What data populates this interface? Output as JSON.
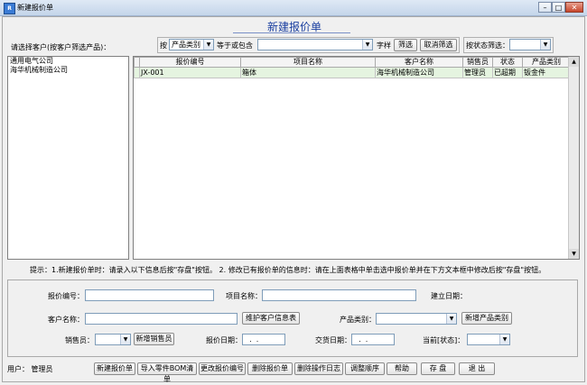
{
  "window": {
    "title": "新建报价单",
    "app_icon": "app-icon"
  },
  "heading": "新建报价单",
  "customer_filter_label": "请选择客户(按客户筛选产品)：",
  "customers": [
    "通用电气公司",
    "海华机械制造公司"
  ],
  "filter": {
    "by_label": "按",
    "field_value": "产品类别",
    "op_value": "等于或包含",
    "keyword_value": "",
    "char_label": "字样",
    "filter_button": "筛选",
    "cancel_button": "取消筛选",
    "status_label": "按状态筛选：",
    "status_value": ""
  },
  "table": {
    "columns": [
      "报价编号",
      "项目名称",
      "客户名称",
      "销售员",
      "状态",
      "产品类别"
    ],
    "rows": [
      [
        "JX-001",
        "箱体",
        "海华机械制造公司",
        "管理员",
        "已超期",
        "钣金件"
      ]
    ]
  },
  "hint": "提示：1.新建报价单时：请录入以下信息后按\"存盘\"按钮。  2. 修改已有报价单的信息时：请在上面表格中单击选中报价单并在下方文本框中修改后按\"存盘\"按钮。",
  "form": {
    "quote_no_label": "报价编号：",
    "quote_no_value": "",
    "project_label": "项目名称：",
    "project_value": "",
    "created_label": "建立日期：",
    "created_value": "",
    "customer_label": "客户名称：",
    "customer_value": "",
    "maintain_customer_button": "维护客户信息表",
    "category_label": "产品类别：",
    "category_value": "",
    "new_category_button": "新增产品类别",
    "sales_label": "销售员：",
    "sales_value": "",
    "new_sales_button": "新增销售员",
    "quote_date_label": "报价日期：",
    "quote_date_value": "  .  .",
    "delivery_label": "交货日期：",
    "delivery_value": "  .  .",
    "cur_status_label": "当前[状态]：",
    "cur_status_value": ""
  },
  "footer": {
    "user_label": "用户：",
    "user_value": "管理员",
    "buttons": [
      "新建报价单",
      "导入零件BOM清单",
      "更改报价编号",
      "删除报价单",
      "删除操作日志",
      "调整顺序",
      "帮助",
      "存 盘",
      "退 出"
    ]
  },
  "colors": {
    "heading": "#1a3fa0",
    "selected_row": "#e5f4e0"
  }
}
